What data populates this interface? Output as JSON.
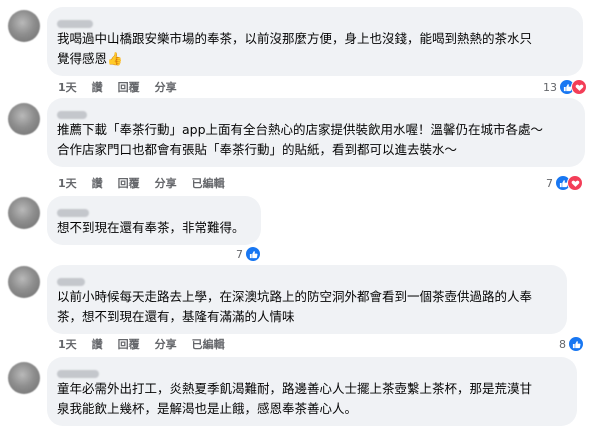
{
  "comments": [
    {
      "text_lines": [
        "我喝過中山橋跟安樂市場的奉茶，以前沒那麼方便，身上也沒錢，能喝到熱熱的茶水只",
        "覺得感恩👍"
      ],
      "actions": [
        "1天",
        "讚",
        "回覆",
        "分享"
      ],
      "reaction_count": "13",
      "reaction_icons": [
        "like-icon",
        "love-icon"
      ]
    },
    {
      "text_lines": [
        "推薦下載「奉茶行動」app上面有全台熱心的店家提供裝飲用水喔！溫馨仍在城市各處～",
        "合作店家門口也都會有張貼「奉茶行動」的貼紙，看到都可以進去裝水～"
      ],
      "actions": [
        "1天",
        "讚",
        "回覆",
        "分享",
        "已編輯"
      ],
      "reaction_count": "7",
      "reaction_icons": [
        "like-icon",
        "love-icon"
      ]
    },
    {
      "text_lines": [
        "想不到現在還有奉茶，非常難得。"
      ],
      "actions": [
        "1天",
        "讚",
        "回覆",
        "分享"
      ],
      "reaction_count": "7",
      "reaction_icons": [
        "like-icon"
      ]
    },
    {
      "text_lines": [
        "以前小時候每天走路去上學，在深澳坑路上的防空洞外都會看到一個茶壺供過路的人奉",
        "茶，想不到現在還有，基隆有滿滿的人情味"
      ],
      "actions": [
        "1天",
        "讚",
        "回覆",
        "分享",
        "已編輯"
      ],
      "reaction_count": "8",
      "reaction_icons": [
        "like-icon"
      ]
    },
    {
      "text_lines": [
        "童年必需外出打工，炎熱夏季飢渴難耐，路邊善心人士擺上茶壺繫上茶杯，那是荒漠甘",
        "泉我能飲上幾杯，是解渴也是止餓，感恩奉茶善心人。"
      ],
      "actions": [],
      "reaction_count": "",
      "reaction_icons": []
    }
  ],
  "colors": {
    "bubble": "#f0f2f5",
    "text": "#050505",
    "secondary": "#65676b",
    "like": "#1877f2",
    "love": "#f33e58"
  }
}
